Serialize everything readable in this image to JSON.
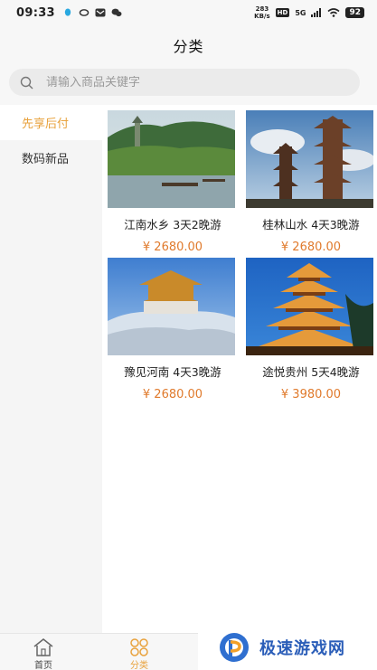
{
  "status": {
    "time": "09:33",
    "net_speed_value": "283",
    "net_speed_unit": "KB/s",
    "hd": "HD",
    "signal": "5G",
    "battery": "92"
  },
  "header": {
    "title": "分类"
  },
  "search": {
    "placeholder": "请输入商品关键字"
  },
  "sidebar": {
    "items": [
      {
        "label": "先享后付",
        "active": true
      },
      {
        "label": "数码新品",
        "active": false
      }
    ]
  },
  "products": [
    {
      "title": "江南水乡 3天2晚游",
      "price": "¥ 2680.00",
      "image": "pagoda-lake-photo"
    },
    {
      "title": "桂林山水 4天3晚游",
      "price": "¥ 2680.00",
      "image": "tall-pagoda-photo"
    },
    {
      "title": "豫见河南 4天3晚游",
      "price": "¥ 2680.00",
      "image": "snowy-temple-photo"
    },
    {
      "title": "途悦贵州 5天4晚游",
      "price": "¥ 3980.00",
      "image": "lit-drum-tower-photo"
    }
  ],
  "tabbar": {
    "items": [
      {
        "label": "首页",
        "icon": "home-icon",
        "active": false
      },
      {
        "label": "分类",
        "icon": "category-icon",
        "active": true
      }
    ]
  },
  "watermark": {
    "text": "极速游戏网"
  },
  "colors": {
    "accent": "#e8a23d",
    "price": "#e07a2c",
    "watermark": "#2a5db8"
  }
}
